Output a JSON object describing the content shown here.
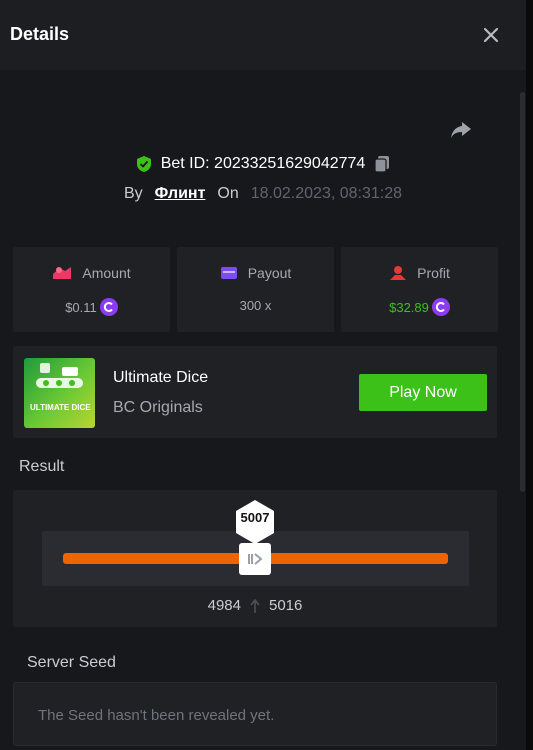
{
  "header": {
    "title": "Details"
  },
  "bet": {
    "id_label": "Bet ID: 20233251629042774",
    "by_label": "By",
    "user": "Флинт",
    "on_label": "On",
    "date": "18.02.2023, 08:31:28"
  },
  "stats": {
    "amount": {
      "title": "Amount",
      "value": "$0.11"
    },
    "payout": {
      "title": "Payout",
      "value": "300 x"
    },
    "profit": {
      "title": "Profit",
      "value": "$32.89"
    }
  },
  "game": {
    "name": "Ultimate Dice",
    "provider": "BC Originals",
    "thumb_text": "ULTIMATE DICE",
    "play_label": "Play Now"
  },
  "result": {
    "label": "Result",
    "roll": "5007",
    "range_low": "4984",
    "range_high": "5016"
  },
  "seed": {
    "label": "Server Seed",
    "text": "The Seed hasn't been revealed yet."
  },
  "colors": {
    "accent_green": "#3bc117",
    "bar_orange": "#ed6400",
    "coin_purple": "#8b3cf0",
    "amount_pink": "#e93a66",
    "payout_purple": "#7b4df0",
    "profit_red": "#e53935"
  },
  "icons": [
    "close-icon",
    "share-icon",
    "shield-check-icon",
    "copy-icon",
    "amount-icon",
    "wallet-icon",
    "profit-icon",
    "coin-icon",
    "slider-handle-icon",
    "range-arrow-icon"
  ]
}
